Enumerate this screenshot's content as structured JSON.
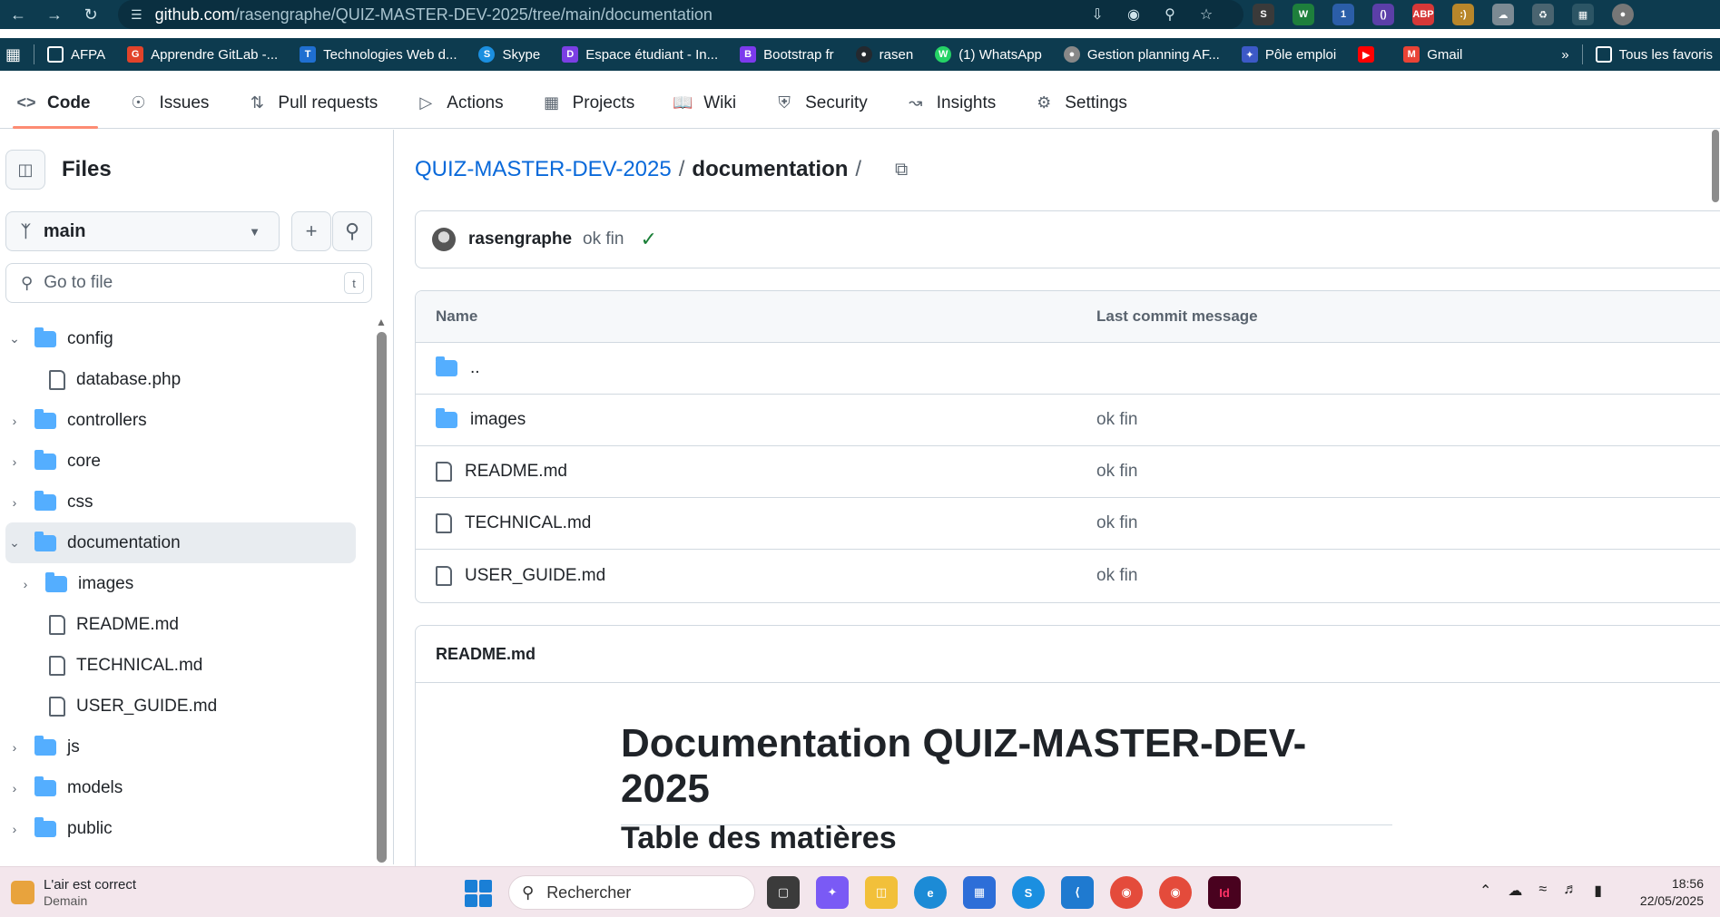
{
  "browser": {
    "url_host": "github.com",
    "url_path": "/rasengraphe/QUIZ-MASTER-DEV-2025/tree/main/documentation",
    "bookmarks": [
      {
        "label": "AFPA",
        "icon": "folder-icon",
        "color": "#f0c24b"
      },
      {
        "label": "Apprendre GitLab -...",
        "icon": "gitlab-icon",
        "color": "#e2432a"
      },
      {
        "label": "Technologies Web d...",
        "icon": "trello-icon",
        "color": "#1f6fd1"
      },
      {
        "label": "Skype",
        "icon": "skype-icon",
        "color": "#1b8fe0"
      },
      {
        "label": "Espace étudiant - In...",
        "icon": "student-icon",
        "color": "#7b3fe4"
      },
      {
        "label": "Bootstrap fr",
        "icon": "bootstrap-icon",
        "color": "#7c3aed"
      },
      {
        "label": "rasen",
        "icon": "github-icon",
        "color": "#24292f"
      },
      {
        "label": "(1) WhatsApp",
        "icon": "whatsapp-icon",
        "color": "#25d366"
      },
      {
        "label": "Gestion planning AF...",
        "icon": "globe-icon",
        "color": "#888888"
      },
      {
        "label": "Pôle emploi",
        "icon": "pole-emploi-icon",
        "color": "#3c59c7"
      },
      {
        "label": "",
        "icon": "youtube-icon",
        "color": "#ff0000"
      },
      {
        "label": "Gmail",
        "icon": "gmail-icon",
        "color": "#ea4335"
      }
    ],
    "favorites_label": "Tous les favoris"
  },
  "repo_nav": {
    "tabs": [
      {
        "label": "Code",
        "icon": "code-icon",
        "active": true
      },
      {
        "label": "Issues",
        "icon": "issues-icon"
      },
      {
        "label": "Pull requests",
        "icon": "pull-request-icon"
      },
      {
        "label": "Actions",
        "icon": "play-icon"
      },
      {
        "label": "Projects",
        "icon": "table-icon"
      },
      {
        "label": "Wiki",
        "icon": "book-icon"
      },
      {
        "label": "Security",
        "icon": "shield-icon"
      },
      {
        "label": "Insights",
        "icon": "graph-icon"
      },
      {
        "label": "Settings",
        "icon": "gear-icon"
      }
    ]
  },
  "sidebar": {
    "title": "Files",
    "branch": "main",
    "goto_placeholder": "Go to file",
    "goto_shortcut": "t",
    "tree": [
      {
        "label": "config",
        "type": "folder",
        "open": true
      },
      {
        "label": "database.php",
        "type": "file"
      },
      {
        "label": "controllers",
        "type": "folder"
      },
      {
        "label": "core",
        "type": "folder"
      },
      {
        "label": "css",
        "type": "folder"
      },
      {
        "label": "documentation",
        "type": "folder",
        "open": true,
        "active": true
      },
      {
        "label": "images",
        "type": "folder"
      },
      {
        "label": "README.md",
        "type": "file"
      },
      {
        "label": "TECHNICAL.md",
        "type": "file"
      },
      {
        "label": "USER_GUIDE.md",
        "type": "file"
      },
      {
        "label": "js",
        "type": "folder"
      },
      {
        "label": "models",
        "type": "folder"
      },
      {
        "label": "public",
        "type": "folder"
      }
    ]
  },
  "main": {
    "breadcrumb_repo": "QUIZ-MASTER-DEV-2025",
    "breadcrumb_sep": "/",
    "breadcrumb_current": "documentation",
    "commit": {
      "author": "rasengraphe",
      "message": "ok fin"
    },
    "table": {
      "col_name": "Name",
      "col_message": "Last commit message",
      "rows": [
        {
          "name": "..",
          "type": "folder",
          "message": ""
        },
        {
          "name": "images",
          "type": "folder",
          "message": "ok fin"
        },
        {
          "name": "README.md",
          "type": "file",
          "message": "ok fin"
        },
        {
          "name": "TECHNICAL.md",
          "type": "file",
          "message": "ok fin"
        },
        {
          "name": "USER_GUIDE.md",
          "type": "file",
          "message": "ok fin"
        }
      ]
    },
    "readme": {
      "filename": "README.md",
      "h1": "Documentation QUIZ-MASTER-DEV-2025",
      "h2": "Table des matières"
    }
  },
  "taskbar": {
    "weather_title": "L'air est correct",
    "weather_sub": "Demain",
    "search_placeholder": "Rechercher",
    "time": "18:56",
    "date": "22/05/2025"
  }
}
